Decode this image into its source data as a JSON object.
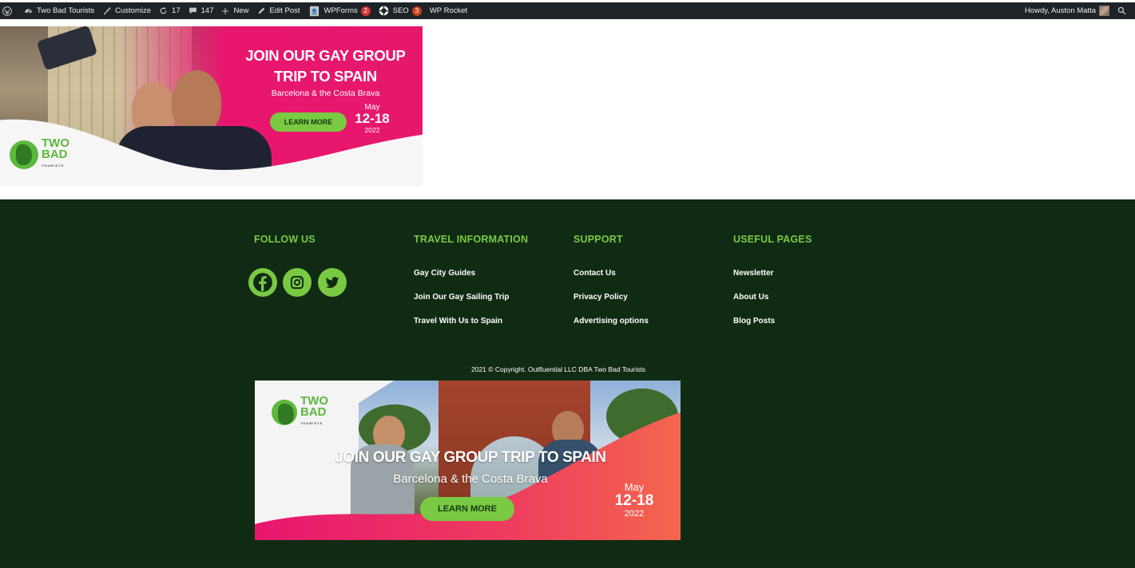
{
  "adminbar": {
    "site_name": "Two Bad Tourists",
    "customize": "Customize",
    "updates_count": "17",
    "comments_count": "147",
    "new_label": "New",
    "edit_post": "Edit Post",
    "wpforms": "WPForms",
    "wpforms_badge": "2",
    "seo": "SEO",
    "seo_badge": "3",
    "wp_rocket": "WP Rocket",
    "howdy": "Howdy, Auston Matta"
  },
  "banner_top": {
    "title_line1": "JOIN OUR GAY GROUP",
    "title_line2": "TRIP TO SPAIN",
    "subtitle": "Barcelona & the Costa Brava",
    "button": "LEARN MORE",
    "month": "May",
    "days": "12-18",
    "year": "2022",
    "logo_line1": "TWO",
    "logo_line2": "BAD",
    "logo_small": "TOURISTS"
  },
  "footer": {
    "columns": [
      {
        "title": "FOLLOW US",
        "links": []
      },
      {
        "title": "TRAVEL INFORMATION",
        "links": [
          "Gay City Guides",
          "Join Our Gay Sailing Trip",
          "Travel With Us to Spain"
        ]
      },
      {
        "title": "SUPPORT",
        "links": [
          "Contact Us",
          "Privacy Policy",
          "Advertising options"
        ]
      },
      {
        "title": "USEFUL PAGES",
        "links": [
          "Newsletter",
          "About Us",
          "Blog Posts"
        ]
      }
    ],
    "social": [
      "facebook-icon",
      "instagram-icon",
      "twitter-icon"
    ],
    "copyright": "2021 © Copyright. Outfluential LLC DBA Two Bad Tourists"
  },
  "banner_bottom": {
    "title": "JOIN OUR GAY GROUP TRIP TO SPAIN",
    "subtitle": "Barcelona & the Costa Brava",
    "button": "LEARN MORE",
    "month": "May",
    "days": "12-18",
    "year": "2022",
    "logo_line1": "TWO",
    "logo_line2": "BAD",
    "logo_small": "TOURISTS"
  },
  "colors": {
    "adminbar_bg": "#1d2327",
    "footer_bg": "#102b13",
    "accent_green": "#7ac943",
    "banner_pink": "#e8166f"
  }
}
